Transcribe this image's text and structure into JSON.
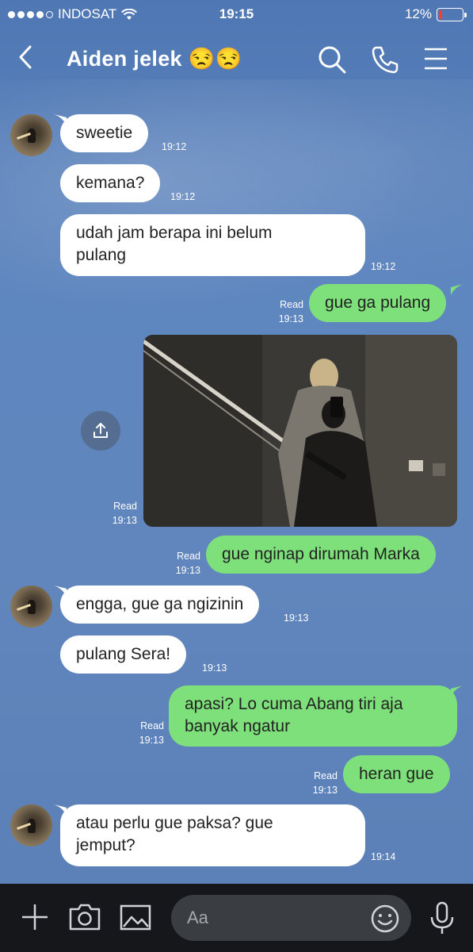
{
  "status_bar": {
    "carrier": "INDOSAT",
    "time": "19:15",
    "battery": "12%"
  },
  "header": {
    "title": "Aiden jelek 😒😒",
    "icons": [
      "back-chevron",
      "search-icon",
      "phone-icon",
      "menu-icon"
    ]
  },
  "messages": [
    {
      "side": "in",
      "text": "sweetie",
      "time": "19:12"
    },
    {
      "side": "in",
      "text": "kemana?",
      "time": "19:12"
    },
    {
      "side": "in",
      "text": "udah jam berapa ini belum\npulang",
      "time": "19:12"
    },
    {
      "side": "out",
      "text": "gue ga pulang",
      "read": "Read",
      "time": "19:13"
    },
    {
      "side": "out",
      "type": "photo",
      "read": "Read",
      "time": "19:13"
    },
    {
      "side": "out",
      "text": "gue nginap dirumah Marka",
      "read": "Read",
      "time": "19:13"
    },
    {
      "side": "in",
      "text": "engga, gue ga ngizinin",
      "time": "19:13"
    },
    {
      "side": "in",
      "text": "pulang Sera!",
      "time": "19:13"
    },
    {
      "side": "out",
      "text": "apasi? Lo cuma Abang tiri aja\nbanyak ngatur",
      "read": "Read",
      "time": "19:13"
    },
    {
      "side": "out",
      "text": "heran gue",
      "read": "Read",
      "time": "19:13"
    },
    {
      "side": "in",
      "text": "atau perlu gue paksa? gue\njemput?",
      "time": "19:14"
    }
  ],
  "composer": {
    "placeholder": "Aa",
    "icons": [
      "plus-icon",
      "camera-icon",
      "image-icon",
      "emoji-icon",
      "microphone-icon"
    ]
  },
  "colors": {
    "background": "#5a7fb8",
    "incoming_bubble": "#ffffff",
    "outgoing_bubble": "#7ee07a",
    "bottom_bar": "#15171b"
  }
}
